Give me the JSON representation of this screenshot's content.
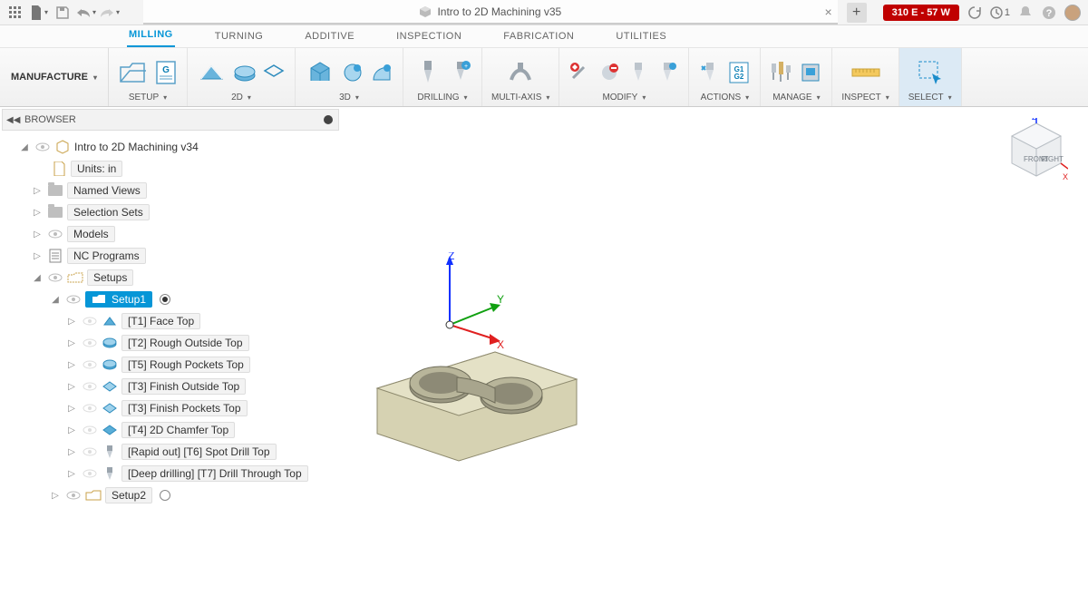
{
  "title": "Intro to 2D Machining v35",
  "status_pill": "310 E - 57 W",
  "notif_count": "1",
  "workspace_label": "MANUFACTURE",
  "subtabs": {
    "milling": "MILLING",
    "turning": "TURNING",
    "additive": "ADDITIVE",
    "inspection": "INSPECTION",
    "fabrication": "FABRICATION",
    "utilities": "UTILITIES"
  },
  "ribbon": {
    "setup": "SETUP",
    "twod": "2D",
    "threed": "3D",
    "drilling": "DRILLING",
    "multiaxis": "MULTI-AXIS",
    "modify": "MODIFY",
    "actions": "ACTIONS",
    "manage": "MANAGE",
    "inspect": "INSPECT",
    "select": "SELECT"
  },
  "browser": {
    "title": "BROWSER",
    "root": "Intro to 2D Machining v34",
    "units": "Units: in",
    "named_views": "Named Views",
    "selection_sets": "Selection Sets",
    "models": "Models",
    "nc_programs": "NC Programs",
    "setups": "Setups",
    "setup1": "Setup1",
    "setup2": "Setup2",
    "ops": [
      "[T1] Face Top",
      "[T2] Rough Outside Top",
      "[T5] Rough Pockets Top",
      "[T3] Finish Outside Top",
      "[T3] Finish Pockets Top",
      "[T4] 2D Chamfer Top",
      "[Rapid out] [T6] Spot Drill Top",
      "[Deep drilling] [T7] Drill Through Top"
    ]
  },
  "axes": {
    "x": "X",
    "y": "Y",
    "z": "Z"
  },
  "viewcube": {
    "front": "FRONT",
    "right": "RIGHT",
    "z": "Z",
    "x": "X"
  }
}
